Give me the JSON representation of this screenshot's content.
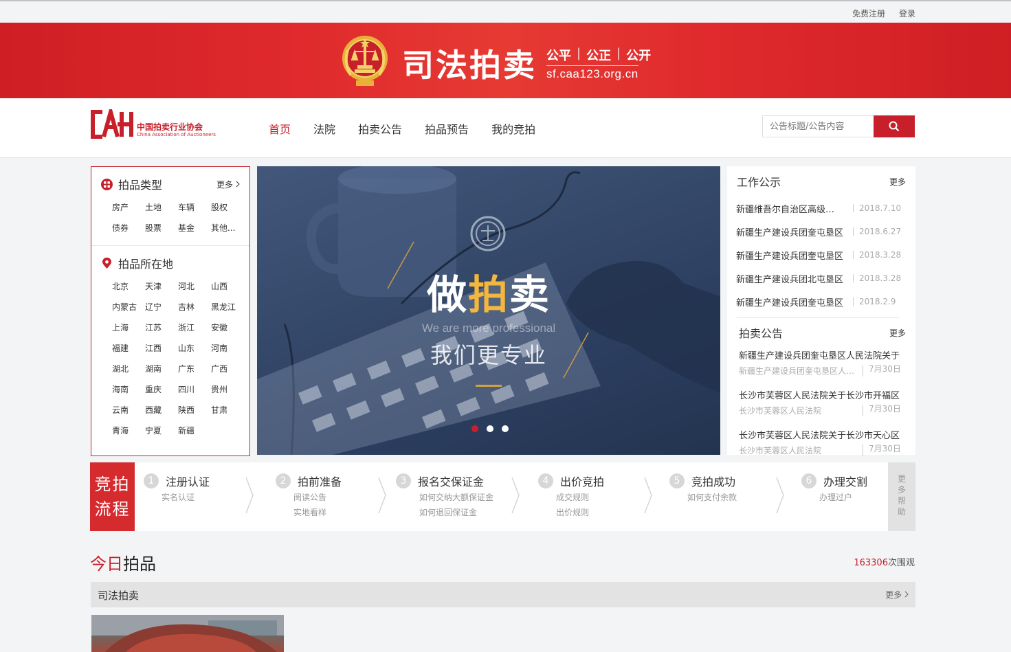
{
  "topbar": {
    "register": "免费注册",
    "login": "登录"
  },
  "banner": {
    "title": "司法拍卖",
    "motto": [
      "公平",
      "公正",
      "公开"
    ],
    "url": "sf.caa123.org.cn"
  },
  "logo": {
    "cn": "中国拍卖行业协会",
    "en": "China Association of Auctioneers"
  },
  "nav": {
    "items": [
      "首页",
      "法院",
      "拍卖公告",
      "拍品预告",
      "我的竞拍"
    ],
    "active_index": 0
  },
  "search": {
    "placeholder": "公告标题/公告内容"
  },
  "categories": {
    "type_title": "拍品类型",
    "type_more": "更多",
    "types": [
      "房产",
      "土地",
      "车辆",
      "股权",
      "债券",
      "股票",
      "基金",
      "其他..."
    ],
    "location_title": "拍品所在地",
    "locations": [
      "北京",
      "天津",
      "河北",
      "山西",
      "内蒙古",
      "辽宁",
      "吉林",
      "黑龙江",
      "上海",
      "江苏",
      "浙江",
      "安徽",
      "福建",
      "江西",
      "山东",
      "河南",
      "湖北",
      "湖南",
      "广东",
      "广西",
      "海南",
      "重庆",
      "四川",
      "贵州",
      "云南",
      "西藏",
      "陕西",
      "甘肃",
      "青海",
      "宁夏",
      "新疆"
    ]
  },
  "carousel": {
    "slogan_pre": "做",
    "slogan_hl": "拍",
    "slogan_post": "卖",
    "slogan_en": "We are more professional",
    "slogan_cn": "我们更专业",
    "slides": 3,
    "active_slide": 0
  },
  "work_notice": {
    "title": "工作公示",
    "more": "更多",
    "items": [
      {
        "title": "新疆维吾尔自治区高级人民法院",
        "date": "2018.7.10"
      },
      {
        "title": "新疆生产建设兵团奎屯垦区",
        "date": "2018.6.27"
      },
      {
        "title": "新疆生产建设兵团奎屯垦区",
        "date": "2018.3.28"
      },
      {
        "title": "新疆生产建设兵团北屯垦区",
        "date": "2018.3.28"
      },
      {
        "title": "新疆生产建设兵团奎屯垦区",
        "date": "2018.2.9"
      }
    ]
  },
  "auction_notice": {
    "title": "拍卖公告",
    "more": "更多",
    "items": [
      {
        "title": "新疆生产建设兵团奎屯垦区人民法院关于",
        "court": "新疆生产建设兵团奎屯垦区人民法院",
        "date": "7月30日"
      },
      {
        "title": "长沙市芙蓉区人民法院关于长沙市开福区",
        "court": "长沙市芙蓉区人民法院",
        "date": "7月30日"
      },
      {
        "title": "长沙市芙蓉区人民法院关于长沙市天心区",
        "court": "长沙市芙蓉区人民法院",
        "date": "7月30日"
      }
    ]
  },
  "process": {
    "label_line1": "竞拍",
    "label_line2": "流程",
    "steps": [
      {
        "num": "1",
        "name": "注册认证",
        "subs": [
          "实名认证"
        ]
      },
      {
        "num": "2",
        "name": "拍前准备",
        "subs": [
          "阅读公告",
          "实地看样"
        ]
      },
      {
        "num": "3",
        "name": "报名交保证金",
        "subs": [
          "如何交纳大额保证金",
          "如何退回保证金"
        ]
      },
      {
        "num": "4",
        "name": "出价竞拍",
        "subs": [
          "成交规则",
          "出价规则"
        ]
      },
      {
        "num": "5",
        "name": "竞拍成功",
        "subs": [
          "如何支付余款"
        ]
      },
      {
        "num": "6",
        "name": "办理交割",
        "subs": [
          "办理过户"
        ]
      }
    ],
    "more_help": "更多帮助"
  },
  "today": {
    "title_red": "今日",
    "title_rest": "拍品",
    "views": "163306",
    "views_suffix": "次围观",
    "section_title": "司法拍卖",
    "section_more": "更多"
  },
  "colors": {
    "brand_red": "#c8202a",
    "banner_red": "#e02a2d",
    "gold": "#f4b73e"
  }
}
